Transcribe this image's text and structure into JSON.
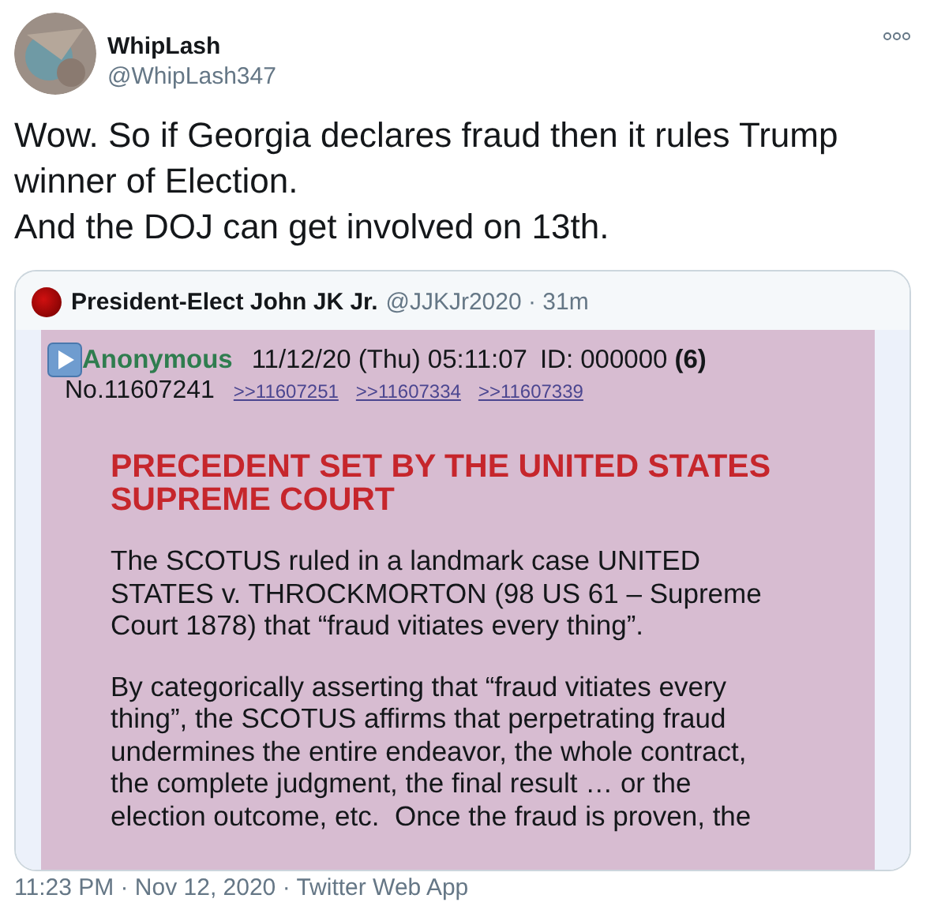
{
  "tweet": {
    "author": {
      "name": "WhipLash",
      "handle": "@WhipLash347"
    },
    "text_lines": [
      "Wow. So if Georgia declares fraud then it rules Trump winner of Election.",
      "And the DOJ can get involved on 13th."
    ],
    "quote": {
      "author": {
        "name": "President-Elect John JK Jr.",
        "handle_time": "@JJKJr2020 · 31m"
      },
      "post": {
        "poster": "Anonymous",
        "date": "11/12/20 (Thu) 05:11:07",
        "id": "ID: 000000 **(6)**",
        "number": "No.11607241",
        "replies": [
          ">>11607251",
          ">>11607334",
          ">>11607339"
        ],
        "heading": "PRECEDENT SET BY THE UNITED STATES SUPREME COURT",
        "paragraphs": [
          "The SCOTUS ruled in a landmark case UNITED STATES v. THROCKMORTON (98 US 61 – Supreme Court 1878) that “fraud vitiates every thing”.",
          "By categorically asserting that “fraud vitiates every thing”, the SCOTUS affirms that perpetrating fraud undermines the entire endeavor, the whole contract, the complete judgment, the final result … or the election outcome, etc.  Once the fraud is proven, the"
        ]
      }
    },
    "footer": "11:23 PM · Nov 12, 2020 · Twitter Web App"
  }
}
